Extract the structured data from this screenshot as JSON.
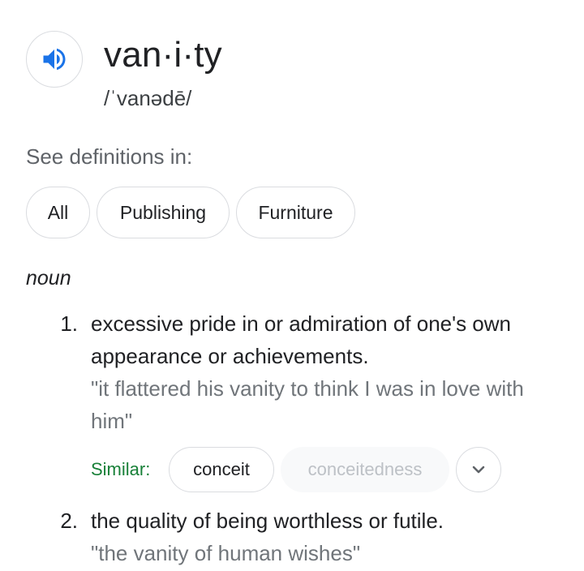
{
  "entry": {
    "word": "van·i·ty",
    "phonetic": "/ˈvanədē/",
    "speaker_icon": "volume-up-icon",
    "accent_color": "#1a73e8"
  },
  "see_definitions": {
    "label": "See definitions in:",
    "chips": [
      "All",
      "Publishing",
      "Furniture"
    ]
  },
  "part_of_speech": "noun",
  "definitions": [
    {
      "number": "1.",
      "text": "excessive pride in or admiration of one's own appearance or achievements.",
      "example": "\"it flattered his vanity to think I was in love with him\"",
      "similar": {
        "label": "Similar:",
        "label_color": "#188038",
        "words": [
          "conceit",
          "conceitedness"
        ],
        "expand_icon": "chevron-down-icon"
      }
    },
    {
      "number": "2.",
      "text": "the quality of being worthless or futile.",
      "example": "\"the vanity of human wishes\""
    }
  ]
}
